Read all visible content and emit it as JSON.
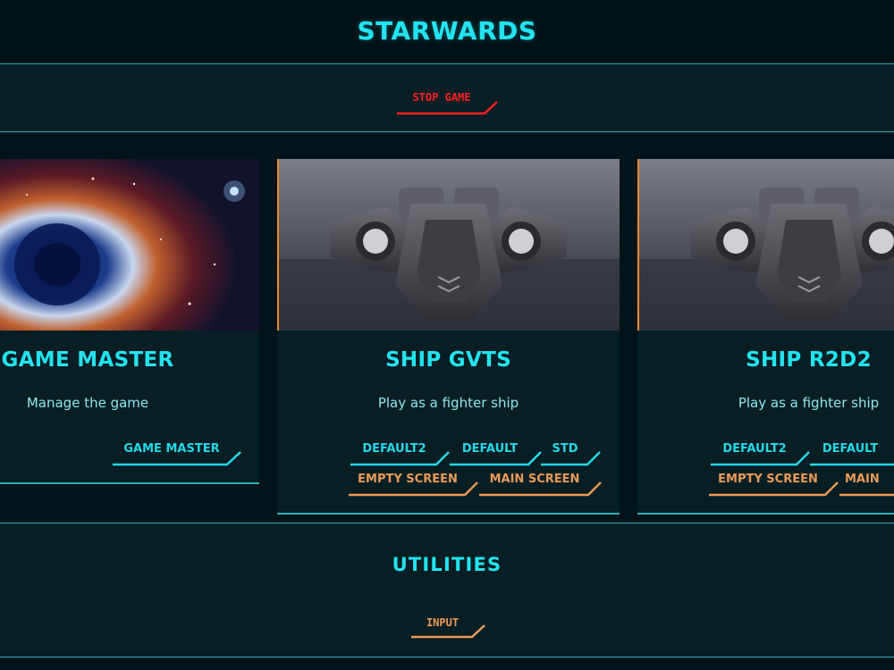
{
  "header": {
    "title": "STARWARDS"
  },
  "controls": {
    "stop_label": "STOP GAME"
  },
  "cards": [
    {
      "name": "GAME MASTER",
      "description": "Manage the game",
      "art": "nebula-image",
      "buttons": [
        {
          "label": "GAME MASTER",
          "color": "cyan"
        }
      ]
    },
    {
      "name": "SHIP GVTS",
      "description": "Play as a fighter ship",
      "art": "spaceship-image",
      "buttons": [
        {
          "label": "DEFAULT2",
          "color": "cyan"
        },
        {
          "label": "DEFAULT",
          "color": "cyan"
        },
        {
          "label": "STD",
          "color": "cyan"
        },
        {
          "label": "EMPTY SCREEN",
          "color": "orange"
        },
        {
          "label": "MAIN SCREEN",
          "color": "orange"
        }
      ]
    },
    {
      "name": "SHIP R2D2",
      "description": "Play as a fighter ship",
      "art": "spaceship-image",
      "buttons": [
        {
          "label": "DEFAULT2",
          "color": "cyan"
        },
        {
          "label": "DEFAULT",
          "color": "cyan"
        },
        {
          "label": "EMPTY SCREEN",
          "color": "orange"
        },
        {
          "label": "MAIN",
          "color": "orange"
        }
      ]
    }
  ],
  "utilities": {
    "title": "UTILITIES",
    "input_label": "INPUT"
  },
  "colors": {
    "accent_cyan": "#22e3ef",
    "accent_orange": "#eb9a55",
    "danger_red": "#ff2020",
    "background": "#02141a",
    "panel": "#061e24"
  }
}
